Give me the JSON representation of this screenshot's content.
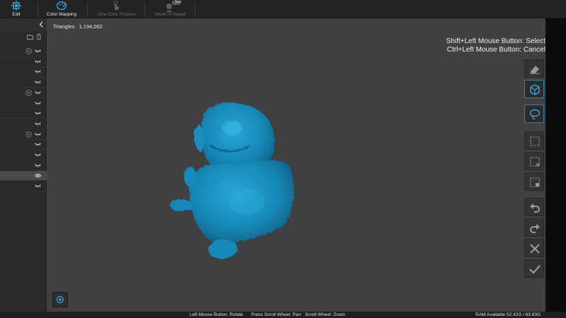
{
  "toolbar": {
    "items": [
      {
        "label": "Edit",
        "icon": "edit-icon",
        "active": true
      },
      {
        "label": "Color Mapping",
        "icon": "color-mapping-icon",
        "active": false
      },
      {
        "label": "One-Click Process",
        "icon": "one-click-process-icon",
        "active": false,
        "disabled": true
      },
      {
        "label": "Head AI Repair",
        "icon": "head-ai-repair-icon",
        "badge": "Test",
        "disabled": true
      }
    ]
  },
  "viewport": {
    "triangles_label": "Triangles",
    "triangles_value": "1,194,062",
    "hint_select": "Shift+Left Mouse Button: Select",
    "hint_cancel": "Ctrl+Left Mouse Button: Cancel",
    "model_color": "#1b8fc0"
  },
  "right_tools": [
    "eraser-icon",
    "cube-select-icon",
    "lasso-icon",
    "rect-select-icon",
    "rect-deselect-icon",
    "delete-selection-icon",
    "undo-icon",
    "redo-icon",
    "cancel-icon",
    "confirm-icon"
  ],
  "status": {
    "rotate": "Left Mouse Button: Rotate",
    "pan": "Press Scroll Wheel: Pan",
    "zoom": "Scroll Wheel: Zoom",
    "ram": "RAM Available 52.42G / 63.83G"
  },
  "colors": {
    "accent": "#2ea3d8",
    "toolbar_bg": "#232325",
    "viewport_bg": "#404043"
  }
}
